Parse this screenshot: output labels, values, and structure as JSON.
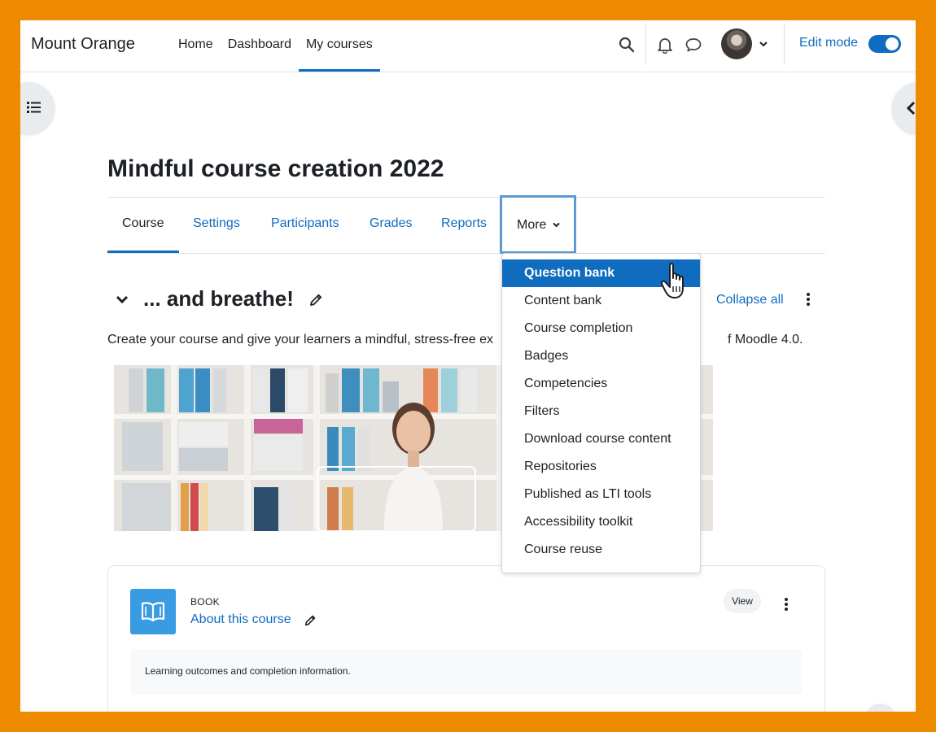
{
  "navbar": {
    "brand": "Mount Orange",
    "links": [
      {
        "label": "Home"
      },
      {
        "label": "Dashboard"
      },
      {
        "label": "My courses",
        "active": true
      }
    ],
    "edit_mode_label": "Edit mode",
    "edit_mode_on": true,
    "icons": [
      "search-icon",
      "bell-icon",
      "chat-icon",
      "avatar",
      "chevron-down-icon"
    ]
  },
  "course": {
    "title": "Mindful course creation 2022",
    "tabs": [
      {
        "label": "Course",
        "active": true
      },
      {
        "label": "Settings"
      },
      {
        "label": "Participants"
      },
      {
        "label": "Grades"
      },
      {
        "label": "Reports"
      },
      {
        "label": "More"
      }
    ]
  },
  "more_menu": {
    "items": [
      "Question bank",
      "Content bank",
      "Course completion",
      "Badges",
      "Competencies",
      "Filters",
      "Download course content",
      "Repositories",
      "Published as LTI tools",
      "Accessibility toolkit",
      "Course reuse"
    ],
    "highlighted": "Question bank"
  },
  "section": {
    "title": "... and breathe!",
    "collapse_all": "Collapse all",
    "summary": "Create your course and give your learners a mindful, stress-free ex",
    "summary_tail": "f Moodle 4.0."
  },
  "activity": {
    "type": "BOOK",
    "name": "About this course",
    "view_label": "View",
    "description": "Learning outcomes and completion information."
  },
  "colors": {
    "frame": "#ee8a00",
    "primary": "#0f6cbf",
    "book_icon": "#399be2",
    "text": "#1d2125"
  }
}
